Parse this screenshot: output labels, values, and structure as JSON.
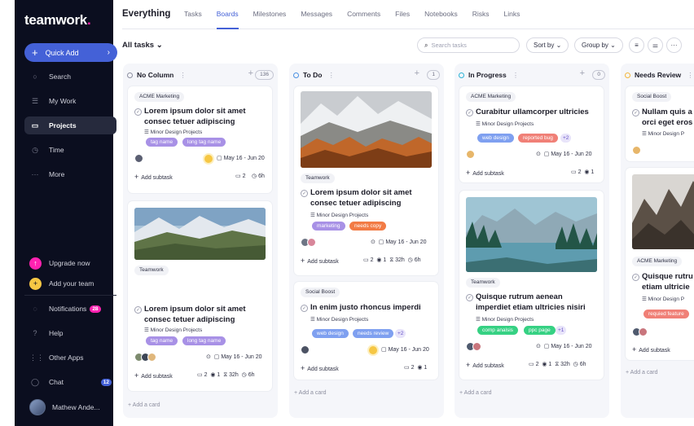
{
  "app": {
    "logo_text": "teamwork",
    "logo_dot": "."
  },
  "sidebar": {
    "quick_add": "Quick Add",
    "items": [
      {
        "label": "Search",
        "icon": "search-icon"
      },
      {
        "label": "My Work",
        "icon": "list-icon"
      },
      {
        "label": "Projects",
        "icon": "folder-icon"
      },
      {
        "label": "Time",
        "icon": "clock-icon"
      },
      {
        "label": "More",
        "icon": "more-icon"
      }
    ],
    "bottom": [
      {
        "label": "Upgrade now"
      },
      {
        "label": "Add your team"
      },
      {
        "label": "Notifications",
        "badge": "28"
      },
      {
        "label": "Help"
      },
      {
        "label": "Other Apps"
      },
      {
        "label": "Chat",
        "badge": "12"
      },
      {
        "label": "Mathew Ande..."
      }
    ]
  },
  "header": {
    "title": "Everything",
    "tabs": [
      "Tasks",
      "Boards",
      "Milestones",
      "Messages",
      "Comments",
      "Files",
      "Notebooks",
      "Risks",
      "Links"
    ]
  },
  "toolbar": {
    "all_tasks": "All tasks",
    "search_placeholder": "Search tasks",
    "sort_by": "Sort by",
    "group_by": "Group by"
  },
  "columns": [
    {
      "name": "No Column",
      "count": "136",
      "color": "#8d8fa0",
      "cards": [
        {
          "tag": "ACME Marketing",
          "title": "Lorem ipsum dolor sit amet consec tetuer adipiscing",
          "project": "Minor Design Projects",
          "labels": [
            "tag name",
            "long tag name"
          ],
          "date": "May 16 - Jun 20",
          "subtask": "Add subtask",
          "comments": "2",
          "time": "6h"
        },
        {
          "tag": "Teamwork",
          "title": "Lorem ipsum dolor sit amet consec tetuer adipiscing",
          "project": "Minor Design Projects",
          "labels": [
            "tag name",
            "long tag name"
          ],
          "date": "May 16 - Jun 20",
          "subtask": "Add subtask",
          "comments": "2",
          "watchers": "1",
          "logged": "32h",
          "time": "6h"
        }
      ],
      "add_card": "Add a card"
    },
    {
      "name": "To Do",
      "count": "1",
      "color": "#4a90e2",
      "cards": [
        {
          "tag": "Teamwork",
          "title": "Lorem ipsum dolor sit amet consec tetuer adipiscing",
          "project": "Minor Design Projects",
          "labels": [
            "marketing",
            "needs copy"
          ],
          "date": "May 16 - Jun 20",
          "subtask": "Add subtask",
          "comments": "2",
          "watchers": "1",
          "logged": "32h",
          "time": "6h"
        },
        {
          "tag": "Social Boost",
          "title": "In enim justo rhoncus imperdi",
          "project": "Minor Design Projects",
          "labels": [
            "web design",
            "needs review"
          ],
          "extra": "+2",
          "date": "May 16 - Jun 20",
          "subtask": "Add subtask",
          "comments": "2",
          "watchers": "1"
        }
      ],
      "add_card": "Add a card"
    },
    {
      "name": "In Progress",
      "count": "0",
      "color": "#2bb3d6",
      "cards": [
        {
          "tag": "ACME Marketing",
          "title": "Curabitur ullamcorper ultricies",
          "project": "Minor Design Projects",
          "labels": [
            "web design",
            "reported bug"
          ],
          "extra": "+2",
          "date": "May 16 - Jun 20",
          "subtask": "Add subtask",
          "comments": "2",
          "watchers": "1"
        },
        {
          "tag": "Teamwork",
          "title": "Quisque rutrum aenean imperdiet etiam ultricies nisiri",
          "project": "Minor Design Projects",
          "labels": [
            "comp analsis",
            "ppc page"
          ],
          "extra": "+1",
          "date": "May 16 - Jun 20",
          "subtask": "Add subtask",
          "comments": "2",
          "watchers": "1",
          "logged": "32h",
          "time": "6h"
        }
      ],
      "add_card": "Add a card"
    },
    {
      "name": "Needs Review",
      "color": "#f4b63b",
      "cards": [
        {
          "tag": "Social Boost",
          "title": "Nullam quis a orci eget eros",
          "project": "Minor Design P"
        },
        {
          "tag": "ACME Marketing",
          "title": "Quisque rutru etiam ultricie",
          "project": "Minor Design P",
          "labels": [
            "requied feature"
          ],
          "subtask": "Add subtask"
        }
      ],
      "add_card": "Add a card"
    }
  ]
}
